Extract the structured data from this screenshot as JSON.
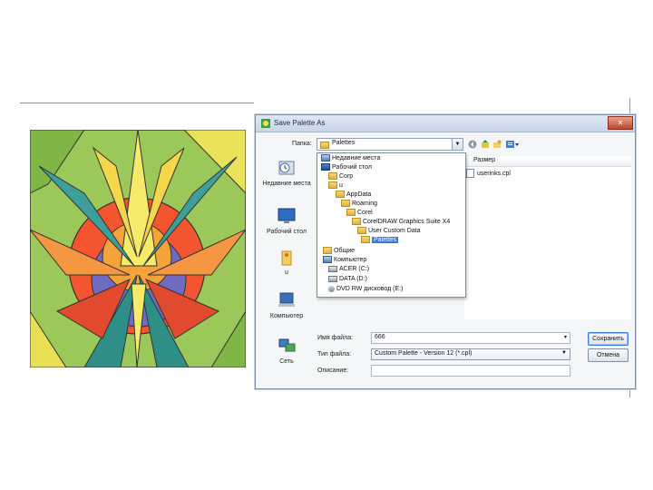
{
  "dialog": {
    "title": "Save Palette As",
    "close_label": "✕",
    "folder_label": "Папка:",
    "folder_value": "Palettes",
    "places": [
      {
        "label": "Недавние места",
        "icon": "recent-places-icon"
      },
      {
        "label": "Рабочий стол",
        "icon": "desktop-icon"
      },
      {
        "label": "u",
        "icon": "user-folder-icon"
      },
      {
        "label": "Компьютер",
        "icon": "computer-icon"
      },
      {
        "label": "Сеть",
        "icon": "network-icon"
      }
    ],
    "column_header": "Размер",
    "file": "userinks.cpl",
    "dropdown": [
      {
        "label": "Недавние места",
        "icon": "recent-places-icon"
      },
      {
        "label": "Рабочий стол",
        "icon": "desktop-icon"
      },
      {
        "label": "Corp",
        "icon": "folder-icon"
      },
      {
        "label": "u",
        "icon": "user-folder-icon"
      },
      {
        "label": "AppData",
        "icon": "folder-icon"
      },
      {
        "label": "Roaming",
        "icon": "folder-icon"
      },
      {
        "label": "Corel",
        "icon": "folder-icon"
      },
      {
        "label": "CorelDRAW Graphics Suite X4",
        "icon": "folder-icon"
      },
      {
        "label": "User Custom Data",
        "icon": "folder-icon"
      },
      {
        "label": "Palettes",
        "icon": "folder-icon",
        "selected": true
      },
      {
        "label": "Общие",
        "icon": "folder-icon"
      },
      {
        "label": "Компьютер",
        "icon": "computer-icon"
      },
      {
        "label": "ACER (C:)",
        "icon": "drive-icon"
      },
      {
        "label": "DATA (D:)",
        "icon": "drive-icon"
      },
      {
        "label": "DVD RW дисковод (E:)",
        "icon": "dvd-drive-icon"
      }
    ],
    "filename_label": "Имя файла:",
    "filename_value": "666",
    "filetype_label": "Тип файла:",
    "filetype_value": "Custom Palette - Version 12 (*.cpl)",
    "description_label": "Описание:",
    "description_value": "",
    "save_button": "Сохранить",
    "cancel_button": "Отмена"
  },
  "colors": {
    "accent": "#3c77c8",
    "titlebar": "#c8d6e8",
    "close": "#c2432a"
  }
}
